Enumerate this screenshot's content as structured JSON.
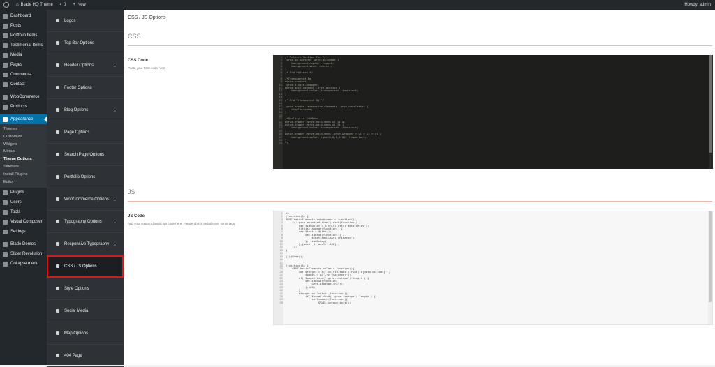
{
  "adminbar": {
    "site_name": "Blade HQ Theme",
    "comments_count": "0",
    "new_label": "New",
    "howdy": "Howdy, admin"
  },
  "menu": {
    "items_top": [
      {
        "label": "Dashboard",
        "icon": "dashboard-icon"
      },
      {
        "label": "Posts",
        "icon": "pin-icon"
      },
      {
        "label": "Portfolio Items",
        "icon": "portfolio-icon"
      },
      {
        "label": "Testimonial Items",
        "icon": "quote-icon"
      },
      {
        "label": "Media",
        "icon": "media-icon"
      },
      {
        "label": "Pages",
        "icon": "pages-icon"
      },
      {
        "label": "Comments",
        "icon": "comment-icon"
      },
      {
        "label": "Contact",
        "icon": "mail-icon"
      }
    ],
    "items_mid": [
      {
        "label": "WooCommerce",
        "icon": "woo-icon"
      },
      {
        "label": "Products",
        "icon": "products-icon"
      }
    ],
    "appearance": "Appearance",
    "appearance_sub": [
      "Themes",
      "Customize",
      "Widgets",
      "Menus",
      "Theme Options",
      "Sidebars",
      "Install Plugins",
      "Editor"
    ],
    "items_bottom": [
      {
        "label": "Plugins",
        "icon": "plugin-icon"
      },
      {
        "label": "Users",
        "icon": "users-icon"
      },
      {
        "label": "Tools",
        "icon": "tools-icon"
      },
      {
        "label": "Visual Composer",
        "icon": "vc-icon"
      },
      {
        "label": "Settings",
        "icon": "settings-icon"
      }
    ],
    "items_extra": [
      {
        "label": "Blade Demos",
        "icon": "demos-icon"
      },
      {
        "label": "Slider Revolution",
        "icon": "slider-icon"
      },
      {
        "label": "Collapse menu",
        "icon": "collapse-icon"
      }
    ]
  },
  "options_nav": [
    {
      "label": "Logos",
      "chevron": false
    },
    {
      "label": "Top Bar Options",
      "chevron": false
    },
    {
      "label": "Header Options",
      "chevron": true
    },
    {
      "label": "Footer Options",
      "chevron": false
    },
    {
      "label": "Blog Options",
      "chevron": true
    },
    {
      "label": "Page Options",
      "chevron": false
    },
    {
      "label": "Search Page Options",
      "chevron": false
    },
    {
      "label": "Portfolio Options",
      "chevron": false
    },
    {
      "label": "WooCommerce Options",
      "chevron": true
    },
    {
      "label": "Typography Options",
      "chevron": true
    },
    {
      "label": "Responsive Typography",
      "chevron": true
    },
    {
      "label": "CSS / JS Options",
      "chevron": false
    },
    {
      "label": "Style Options",
      "chevron": false
    },
    {
      "label": "Social Media",
      "chevron": false
    },
    {
      "label": "Map Options",
      "chevron": false
    },
    {
      "label": "404 Page",
      "chevron": false
    }
  ],
  "main": {
    "page_title": "CSS / JS Options",
    "css_section": "CSS",
    "css_label": "CSS Code",
    "css_desc": "Paste your CSS code here.",
    "css_code": "/* Pattern Section Fix */\n.grve-bg-pattern .grve-bg-image {\n    background-repeat: repeat;\n    background-size: inherit;\n}\n/* End Pattern */\n\n/*Transparent Bg\n#grve-content,\n.grve-single-wrapper,\n#grve-main-content .grve-section {\n    background-color: transparent !important;\n}\n\n/* End Transparent Bg */\n\n.grve-header-responsive-elements .grve-newsletter {\n    display:none;\n}\n\n/*Quality in SubMenu\n#grve-header #grve-main-menu ul li a,\n#grve-header #grve-main-menu ul li {\n    background-color: transparent !important;\n}\n#grve-header #grve-main-menu .grve-wrapper > ul > li > ul {\n    background-color: rgba(0,0,0,0.85) !important;\n}\n*/",
    "js_section": "JS",
    "js_label": "JS Code",
    "js_desc": "Add your custom JavaScript code here. Please do not include any script tags.",
    "js_code": "/*\n(function($) {\nGRVE.basicElements.animAppear = function(){\n    $('.grve-animated-item').each(function() {\n        var timeDelay = $(this).attr('data-delay');\n        $(this).appear(function() {\n        var $that = $(this);\n            setTimeout(function () {\n                $that.addClass('animated');\n            }, timeDelay);\n        },{accX: 0, accY: -150});\n    });\n}\n\n})(jQuery);\n\n\n(function($) {\n    GRVE.basicElements.vcTab = function(){\n        var $target = $('.vc_tta-tabs').find('a[data-vc-tabs]'),\n            $panel = $('.vc_tta-panel');\n        if( $panel.find('.grve-isotope').length ) {\n            setTimeout(function()\n                GRVE.isotope.init();\n            },100);\n        }\n        $target.on('click',function(){\n            if( $panel.find('.grve-isotope').length ) {\n                setTimeout(function(){\n                    GRVE.isotope.init();"
  },
  "colors": {
    "accent": "#0073aa",
    "highlight_outline": "#e0141a",
    "rule": "#f2b6a8"
  }
}
